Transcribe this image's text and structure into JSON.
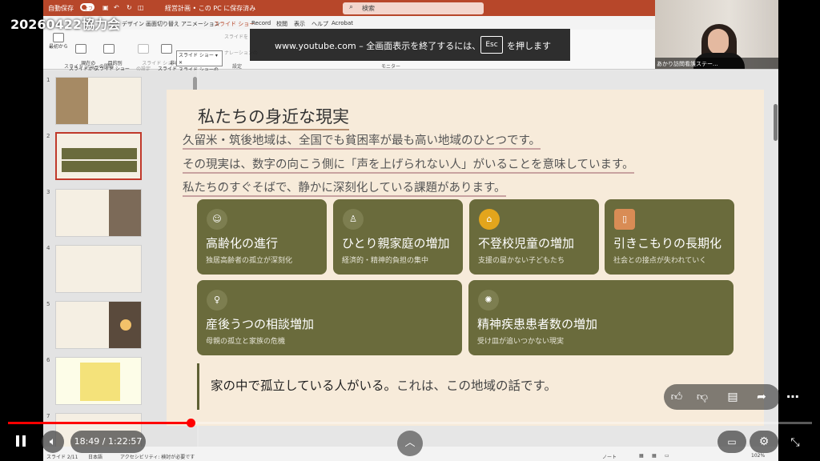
{
  "video": {
    "title": "20260422協力会",
    "time_current": "18:49",
    "time_total": "1:22:57",
    "progress": 0.227
  },
  "fullscreen_notice": {
    "prefix": "www.youtube.com – 全画面表示を終了するには、",
    "key": "Esc",
    "suffix": "を押します"
  },
  "ppt": {
    "autosave_label": "自動保存",
    "autosave_state": "オフ",
    "doc_title": "経営計画 • この PC に保存済み",
    "search_placeholder": "検索",
    "menu": [
      "デザイン",
      "画面切り替え",
      "アニメーション",
      "スライド ショー",
      "Record",
      "校閲",
      "表示",
      "ヘルプ",
      "Acrobat"
    ],
    "active_menu": "スライド ショー",
    "ribbon": {
      "b1": "最初から",
      "b2": "現在の\nスライドから",
      "b3": "目的別\nスライド ショー",
      "b4": "スライド ショー\nの設定",
      "b5": "非表示\nスライド",
      "b6": "スライドを",
      "b7": "ナレーションの",
      "group1": "スライド ショーの開始",
      "group2": "設定",
      "group3": "モニター",
      "dropdown_title": "スライド ショー",
      "dropdown_item": "スライド ショーの再開(R)"
    },
    "status": {
      "slide": "スライド 2/11",
      "lang": "日本語",
      "accessibility": "アクセシビリティ: 検討が必要です",
      "notes": "ノート",
      "zoom": "102%"
    }
  },
  "webcam": {
    "name": "あかり訪問看護ステー..."
  },
  "thumbnails": [
    {
      "num": "1",
      "selected": false
    },
    {
      "num": "2",
      "selected": true
    },
    {
      "num": "3",
      "selected": false
    },
    {
      "num": "4",
      "selected": false
    },
    {
      "num": "5",
      "selected": false
    },
    {
      "num": "6",
      "selected": false
    },
    {
      "num": "7",
      "selected": false
    }
  ],
  "slide": {
    "title": "私たちの身近な現実",
    "lines": [
      "久留米・筑後地域は、全国でも貧困率が最も高い地域のひとつです。",
      "その現実は、数字の向こう側に「声を上げられない人」がいることを意味しています。",
      "私たちのすぐそばで、静かに深刻化している課題があります。"
    ],
    "cards": [
      {
        "title": "高齢化の進行",
        "sub": "独居高齢者の孤立が深刻化",
        "icon": "person-icon"
      },
      {
        "title": "ひとり親家庭の増加",
        "sub": "経済的・精神的負担の集中",
        "icon": "family-icon"
      },
      {
        "title": "不登校児童の増加",
        "sub": "支援の届かない子どもたち",
        "icon": "school-icon"
      },
      {
        "title": "引きこもりの長期化",
        "sub": "社会との接点が失われていく",
        "icon": "door-icon"
      },
      {
        "title": "産後うつの相談増加",
        "sub": "母親の孤立と家族の危機",
        "icon": "mother-icon"
      },
      {
        "title": "精神疾患患者数の増加",
        "sub": "受け皿が追いつかない現実",
        "icon": "brain-icon"
      }
    ],
    "quote_bold": "家の中で孤立している人がいる。",
    "quote_rest": "これは、この地域の話です。"
  }
}
